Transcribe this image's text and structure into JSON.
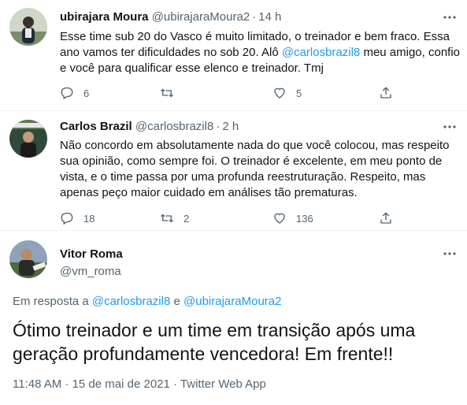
{
  "tweets": [
    {
      "name": "ubirajara Moura",
      "handle": "@ubirajaraMoura2",
      "time": "14 h",
      "lines": [
        "Esse time sub 20 do Vasco é muito limitado, o treinador e bem fraco. Essa",
        "ano vamos ter dificuldades no sob 20. Alô ",
        "@carlosbrazil8",
        " meu amigo, confio",
        "e você para qualificar esse elenco e treinador. Tmj"
      ],
      "replies": "6",
      "retweets": "",
      "likes": "5"
    },
    {
      "name": "Carlos Brazil",
      "handle": "@carlosbrazil8",
      "time": "2 h",
      "lines": [
        "Não concordo em absolutamente nada do que você colocou, mas respeito",
        "sua opinião, como sempre foi. O treinador é excelente, em meu ponto de",
        "vista, e o time passa por uma profunda reestruturação. Respeito, mas",
        "apenas peço maior cuidado em análises tão prematuras."
      ],
      "replies": "18",
      "retweets": "2",
      "likes": "136"
    }
  ],
  "main": {
    "name": "Vitor Roma",
    "handle": "@vm_roma",
    "reply_prefix": "Em resposta a ",
    "reply_mention_1": "@carlosbrazil8",
    "reply_and": " e ",
    "reply_mention_2": "@ubirajaraMoura2",
    "text": "Ótimo treinador e um time em transição após uma geração profundamente vencedora! Em frente!!",
    "timestamp": "11:48 AM · 15 de mai de 2021 · Twitter Web App"
  },
  "colors": {
    "accent": "#1d9bf0",
    "muted": "#536471",
    "text": "#0f1419"
  }
}
